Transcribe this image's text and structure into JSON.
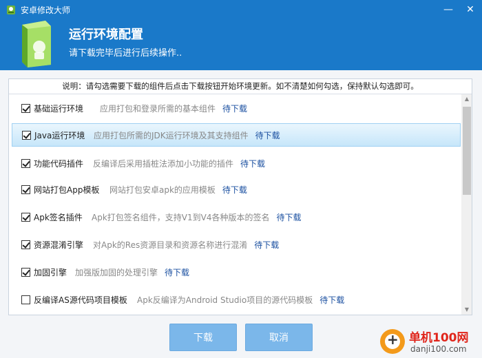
{
  "window": {
    "title": "安卓修改大师"
  },
  "header": {
    "title": "运行环境配置",
    "subtitle": "请下载完毕后进行后续操作.."
  },
  "notice": "说明：请勾选需要下载的组件后点击下载按钮开始环境更新。如不清楚如何勾选，保持默认勾选即可。",
  "components": [
    {
      "name": "基础运行环境",
      "desc": "应用打包和登录所需的基本组件",
      "status": "待下载",
      "checked": true
    },
    {
      "name": "Java运行环境",
      "desc": "应用打包所需的JDK运行环境及其支持组件",
      "status": "待下载",
      "checked": true
    },
    {
      "name": "功能代码插件",
      "desc": "反编译后采用插桩法添加小功能的插件",
      "status": "待下载",
      "checked": true
    },
    {
      "name": "网站打包App模板",
      "desc": "网站打包安卓apk的应用模板",
      "status": "待下载",
      "checked": true
    },
    {
      "name": "Apk签名插件",
      "desc": "Apk打包签名组件，支持V1到V4各种版本的签名",
      "status": "待下载",
      "checked": true
    },
    {
      "name": "资源混淆引擎",
      "desc": "对Apk的Res资源目录和资源名称进行混淆",
      "status": "待下载",
      "checked": true
    },
    {
      "name": "加固引擎",
      "desc": "加强版加固的处理引擎",
      "status": "待下载",
      "checked": true
    },
    {
      "name": "反编译AS源代码项目模板",
      "desc": "Apk反编译为Android Studio项目的源代码模板",
      "status": "待下载",
      "checked": false
    }
  ],
  "buttons": {
    "download": "下载",
    "cancel": "取消"
  },
  "watermark": {
    "brand": "单机100网",
    "domain": "danji100.com"
  },
  "colors": {
    "header_bg": "#1a79c9",
    "button_bg": "#7bb7ea",
    "status_link": "#1a4fa0",
    "watermark_red": "#e0251b",
    "watermark_orange": "#f39a1b"
  }
}
